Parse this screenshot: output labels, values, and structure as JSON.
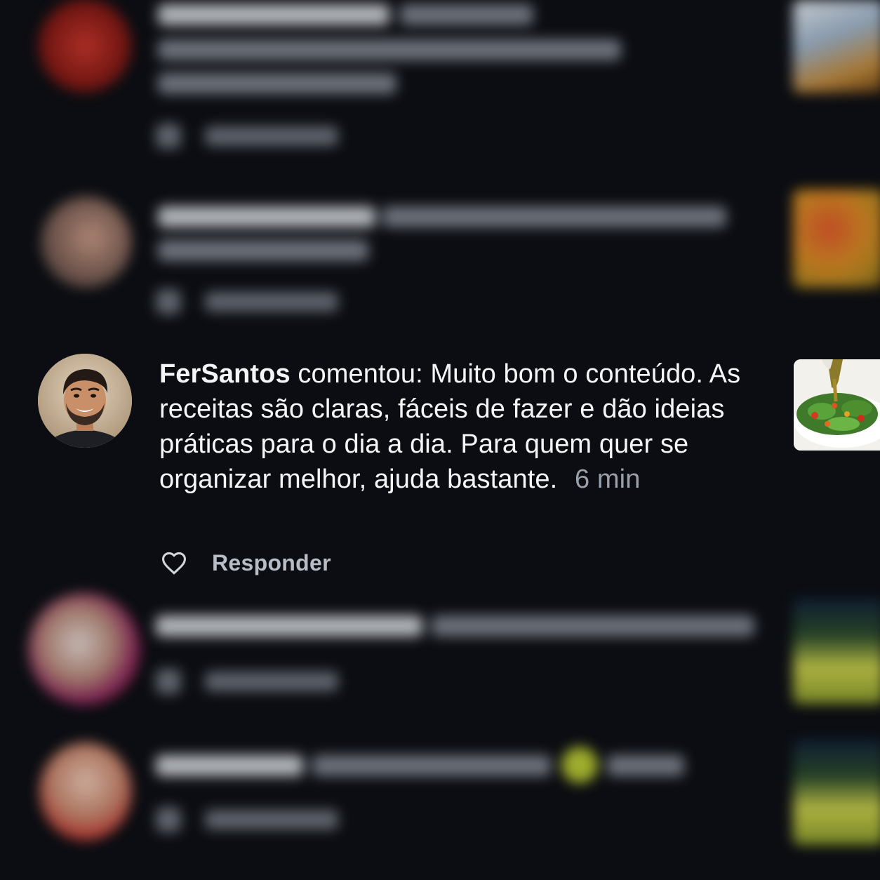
{
  "focused_comment": {
    "username": "FerSantos",
    "text": "comentou: Muito bom o conteúdo. As receitas são claras, fáceis de fazer e dão ideias práticas para o dia a dia. Para quem quer se organizar melhor, ajuda bastante.",
    "time": "6 min",
    "reply_label": "Responder",
    "like_icon": "heart-outline-icon"
  },
  "colors": {
    "background": "#0b0d12",
    "text_primary": "#f4f5f7",
    "text_muted": "#9aa0aa",
    "reply_text": "#b7bcc5"
  }
}
